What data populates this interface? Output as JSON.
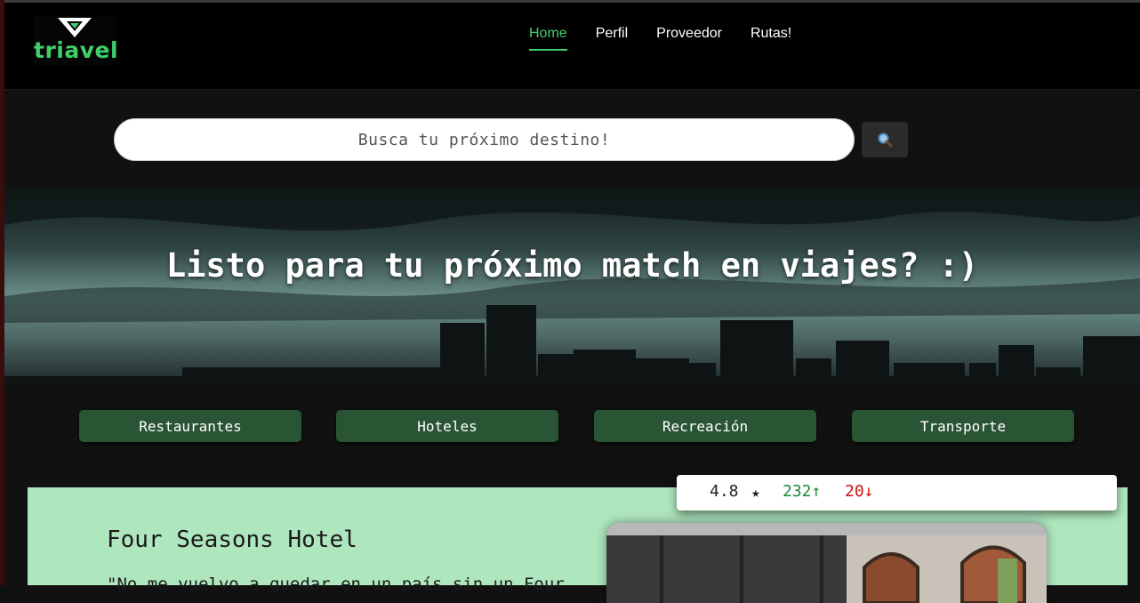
{
  "brand": {
    "name": "triavel",
    "logo_icon": "triangle-logo-icon",
    "accent": "#3fcf6a"
  },
  "nav": {
    "items": [
      {
        "label": "Home",
        "active": true
      },
      {
        "label": "Perfil",
        "active": false
      },
      {
        "label": "Proveedor",
        "active": false
      },
      {
        "label": "Rutas!",
        "active": false
      }
    ]
  },
  "search": {
    "placeholder": "Busca tu próximo destino!",
    "button_icon": "search-icon"
  },
  "hero": {
    "title": "Listo para tu próximo match en viajes? :)"
  },
  "categories": [
    {
      "label": "Restaurantes"
    },
    {
      "label": "Hoteles"
    },
    {
      "label": "Recreación"
    },
    {
      "label": "Transporte"
    }
  ],
  "featured": {
    "title": "Four Seasons Hotel",
    "quote": "\"No me vuelvo a quedar en un país sin un Four",
    "rating": "4.8",
    "rating_icon": "star-icon",
    "upvotes": "232↑",
    "downvotes": "20↓",
    "upvote_color": "#1a8a3a",
    "downvote_color": "#cc1111"
  }
}
